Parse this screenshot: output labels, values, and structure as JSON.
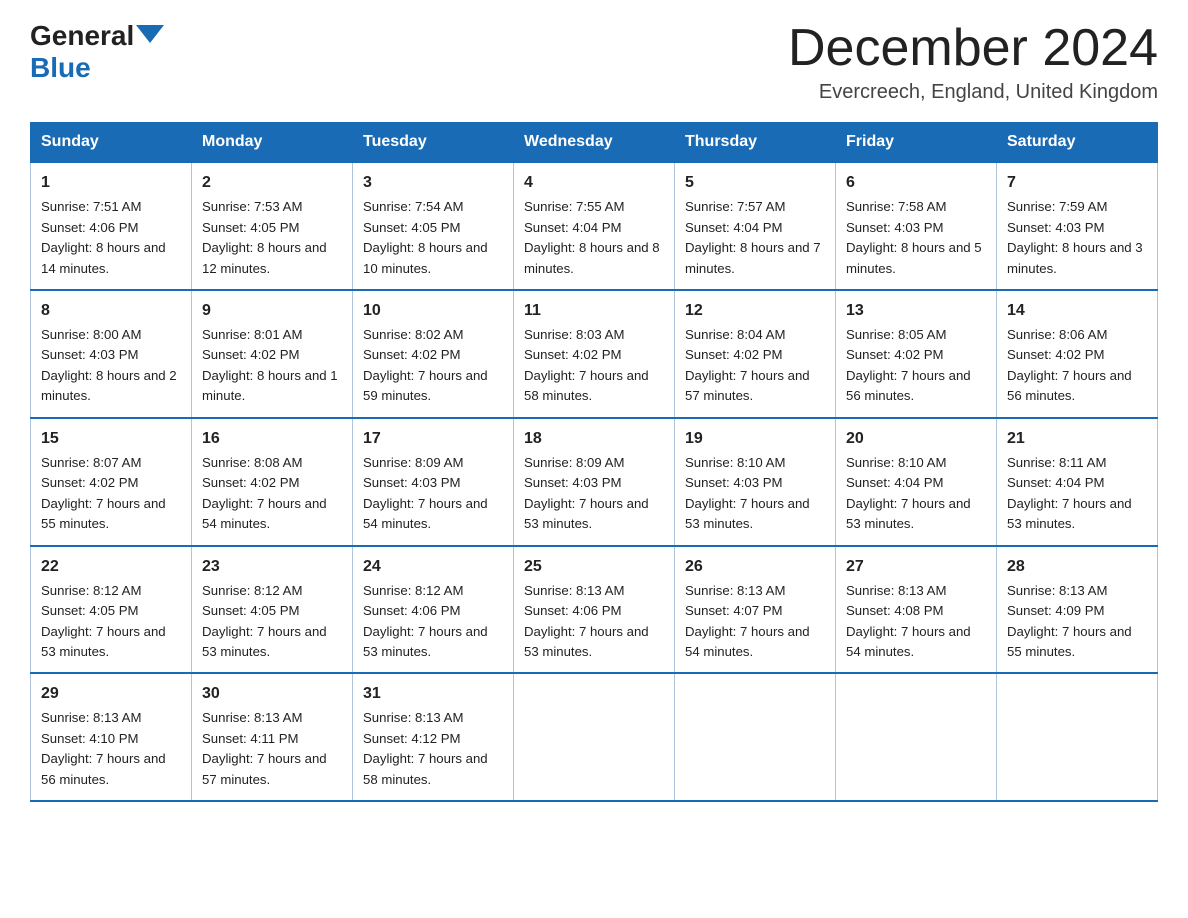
{
  "header": {
    "logo_general": "General",
    "logo_blue": "Blue",
    "title": "December 2024",
    "location": "Evercreech, England, United Kingdom"
  },
  "days_of_week": [
    "Sunday",
    "Monday",
    "Tuesday",
    "Wednesday",
    "Thursday",
    "Friday",
    "Saturday"
  ],
  "weeks": [
    [
      {
        "day": "1",
        "sunrise": "7:51 AM",
        "sunset": "4:06 PM",
        "daylight": "8 hours and 14 minutes."
      },
      {
        "day": "2",
        "sunrise": "7:53 AM",
        "sunset": "4:05 PM",
        "daylight": "8 hours and 12 minutes."
      },
      {
        "day": "3",
        "sunrise": "7:54 AM",
        "sunset": "4:05 PM",
        "daylight": "8 hours and 10 minutes."
      },
      {
        "day": "4",
        "sunrise": "7:55 AM",
        "sunset": "4:04 PM",
        "daylight": "8 hours and 8 minutes."
      },
      {
        "day": "5",
        "sunrise": "7:57 AM",
        "sunset": "4:04 PM",
        "daylight": "8 hours and 7 minutes."
      },
      {
        "day": "6",
        "sunrise": "7:58 AM",
        "sunset": "4:03 PM",
        "daylight": "8 hours and 5 minutes."
      },
      {
        "day": "7",
        "sunrise": "7:59 AM",
        "sunset": "4:03 PM",
        "daylight": "8 hours and 3 minutes."
      }
    ],
    [
      {
        "day": "8",
        "sunrise": "8:00 AM",
        "sunset": "4:03 PM",
        "daylight": "8 hours and 2 minutes."
      },
      {
        "day": "9",
        "sunrise": "8:01 AM",
        "sunset": "4:02 PM",
        "daylight": "8 hours and 1 minute."
      },
      {
        "day": "10",
        "sunrise": "8:02 AM",
        "sunset": "4:02 PM",
        "daylight": "7 hours and 59 minutes."
      },
      {
        "day": "11",
        "sunrise": "8:03 AM",
        "sunset": "4:02 PM",
        "daylight": "7 hours and 58 minutes."
      },
      {
        "day": "12",
        "sunrise": "8:04 AM",
        "sunset": "4:02 PM",
        "daylight": "7 hours and 57 minutes."
      },
      {
        "day": "13",
        "sunrise": "8:05 AM",
        "sunset": "4:02 PM",
        "daylight": "7 hours and 56 minutes."
      },
      {
        "day": "14",
        "sunrise": "8:06 AM",
        "sunset": "4:02 PM",
        "daylight": "7 hours and 56 minutes."
      }
    ],
    [
      {
        "day": "15",
        "sunrise": "8:07 AM",
        "sunset": "4:02 PM",
        "daylight": "7 hours and 55 minutes."
      },
      {
        "day": "16",
        "sunrise": "8:08 AM",
        "sunset": "4:02 PM",
        "daylight": "7 hours and 54 minutes."
      },
      {
        "day": "17",
        "sunrise": "8:09 AM",
        "sunset": "4:03 PM",
        "daylight": "7 hours and 54 minutes."
      },
      {
        "day": "18",
        "sunrise": "8:09 AM",
        "sunset": "4:03 PM",
        "daylight": "7 hours and 53 minutes."
      },
      {
        "day": "19",
        "sunrise": "8:10 AM",
        "sunset": "4:03 PM",
        "daylight": "7 hours and 53 minutes."
      },
      {
        "day": "20",
        "sunrise": "8:10 AM",
        "sunset": "4:04 PM",
        "daylight": "7 hours and 53 minutes."
      },
      {
        "day": "21",
        "sunrise": "8:11 AM",
        "sunset": "4:04 PM",
        "daylight": "7 hours and 53 minutes."
      }
    ],
    [
      {
        "day": "22",
        "sunrise": "8:12 AM",
        "sunset": "4:05 PM",
        "daylight": "7 hours and 53 minutes."
      },
      {
        "day": "23",
        "sunrise": "8:12 AM",
        "sunset": "4:05 PM",
        "daylight": "7 hours and 53 minutes."
      },
      {
        "day": "24",
        "sunrise": "8:12 AM",
        "sunset": "4:06 PM",
        "daylight": "7 hours and 53 minutes."
      },
      {
        "day": "25",
        "sunrise": "8:13 AM",
        "sunset": "4:06 PM",
        "daylight": "7 hours and 53 minutes."
      },
      {
        "day": "26",
        "sunrise": "8:13 AM",
        "sunset": "4:07 PM",
        "daylight": "7 hours and 54 minutes."
      },
      {
        "day": "27",
        "sunrise": "8:13 AM",
        "sunset": "4:08 PM",
        "daylight": "7 hours and 54 minutes."
      },
      {
        "day": "28",
        "sunrise": "8:13 AM",
        "sunset": "4:09 PM",
        "daylight": "7 hours and 55 minutes."
      }
    ],
    [
      {
        "day": "29",
        "sunrise": "8:13 AM",
        "sunset": "4:10 PM",
        "daylight": "7 hours and 56 minutes."
      },
      {
        "day": "30",
        "sunrise": "8:13 AM",
        "sunset": "4:11 PM",
        "daylight": "7 hours and 57 minutes."
      },
      {
        "day": "31",
        "sunrise": "8:13 AM",
        "sunset": "4:12 PM",
        "daylight": "7 hours and 58 minutes."
      },
      null,
      null,
      null,
      null
    ]
  ]
}
